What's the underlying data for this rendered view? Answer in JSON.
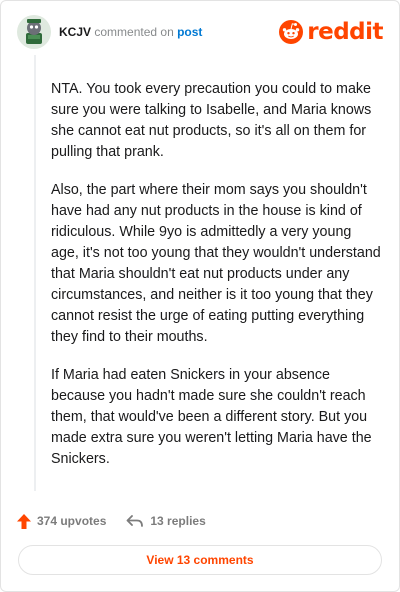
{
  "comment": {
    "author": "KCJV",
    "action_text": "commented on",
    "target_link": "post",
    "brand": "reddit",
    "paragraphs": [
      "NTA. You took every precaution you could to make sure you were talking to Isabelle, and Maria knows she cannot eat nut products, so it's all on them for pulling that prank.",
      "Also, the part where their mom says you shouldn't have had any nut products in the house is kind of ridiculous. While 9yo is admittedly a very young age, it's not too young that they wouldn't understand that Maria shouldn't eat nut products under any circumstances, and neither is it too young that they cannot resist the urge of eating putting everything they find to their mouths.",
      "If Maria had eaten Snickers in your absence because you hadn't made sure she couldn't reach them, that would've been a different story. But you made extra sure you weren't letting Maria have the Snickers."
    ]
  },
  "footer": {
    "upvotes_label": "374 upvotes",
    "replies_label": "13 replies",
    "view_button": "View 13 comments"
  },
  "colors": {
    "accent": "#ff4500",
    "link": "#0079d3",
    "muted": "#878a8c"
  },
  "icons": [
    "avatar",
    "reddit-logo-icon",
    "upvote-arrow-icon",
    "reply-arrow-icon"
  ]
}
